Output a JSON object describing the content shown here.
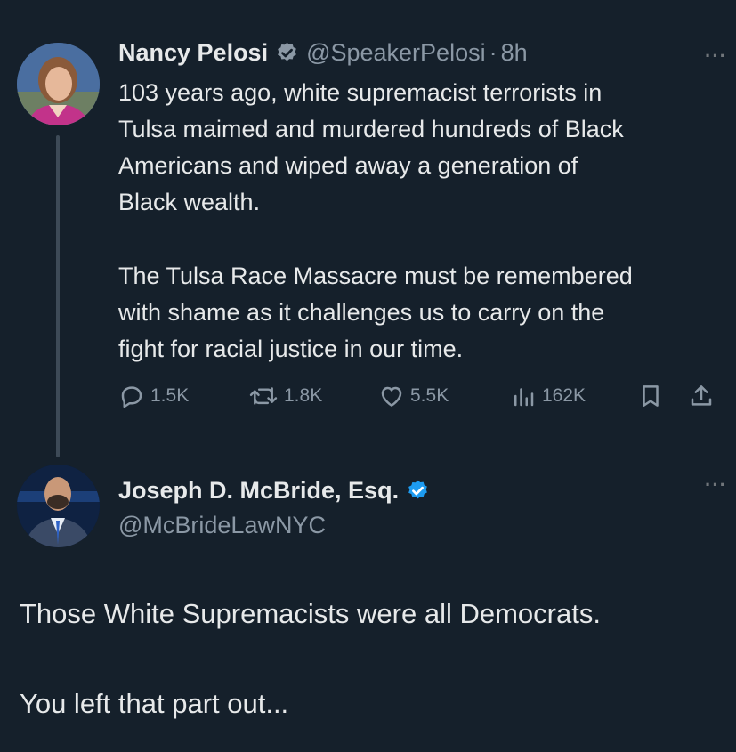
{
  "tweet": {
    "author_name": "Nancy Pelosi",
    "handle": "@SpeakerPelosi",
    "separator": "·",
    "time": "8h",
    "more": "···",
    "paragraph1": "103 years ago, white supremacist terrorists in\nTulsa maimed and murdered hundreds of Black\nAmericans and wiped away a generation of\nBlack wealth.",
    "paragraph2": "The Tulsa Race Massacre must be remembered\nwith shame as it challenges us to carry on the\nfight for racial justice in our time.",
    "stats": {
      "replies": "1.5K",
      "reposts": "1.8K",
      "likes": "5.5K",
      "views": "162K"
    }
  },
  "reply": {
    "author_name": "Joseph D. McBride, Esq.",
    "handle": "@McBrideLawNYC",
    "more": "···",
    "line1": "Those White Supremacists were all Democrats.",
    "line2": "You left that part out..."
  },
  "icons": {
    "verified_gray": "#8b98a5",
    "verified_blue": "#1d9bf0"
  },
  "colors": {
    "background": "#15202b",
    "text": "#e7e9ea",
    "secondary": "#8b98a5"
  }
}
